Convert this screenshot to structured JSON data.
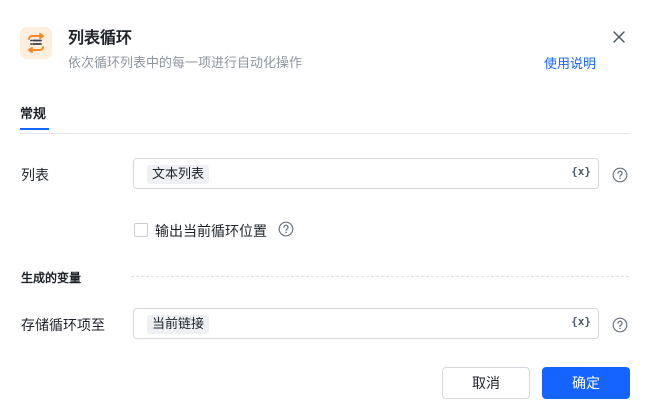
{
  "header": {
    "title": "列表循环",
    "subtitle": "依次循环列表中的每一项进行自动化操作",
    "help_link": "使用说明",
    "icon": "list-loop-icon",
    "accent_color": "#f5882a"
  },
  "tabs": [
    {
      "label": "常规",
      "active": true
    }
  ],
  "form": {
    "list_label": "列表",
    "list_value": "文本列表",
    "var_button": "{x}",
    "output_position_label": "输出当前循环位置",
    "output_position_checked": false,
    "generated_vars_title": "生成的变量",
    "store_label": "存储循环项至",
    "store_value": "当前链接"
  },
  "footer": {
    "cancel_label": "取消",
    "ok_label": "确定"
  },
  "colors": {
    "primary": "#1664ff",
    "border": "#d5d8de",
    "muted": "#8f959e"
  }
}
